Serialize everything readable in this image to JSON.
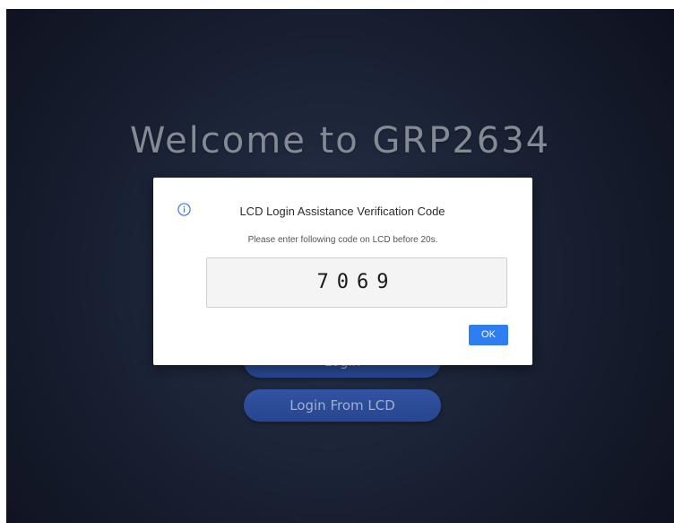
{
  "welcome": {
    "title": "Welcome to GRP2634"
  },
  "buttons": {
    "login_label": "Login",
    "login_from_lcd_label": "Login From LCD"
  },
  "dialog": {
    "icon": "info-icon",
    "title": "LCD Login Assistance Verification Code",
    "message": "Please enter following code on LCD before 20s.",
    "code": "7069",
    "ok_label": "OK"
  },
  "colors": {
    "background_dark": "#1a2134",
    "primary_button": "#2a4a98",
    "ok_button": "#2f7df0",
    "info_icon": "#2f7df0"
  }
}
